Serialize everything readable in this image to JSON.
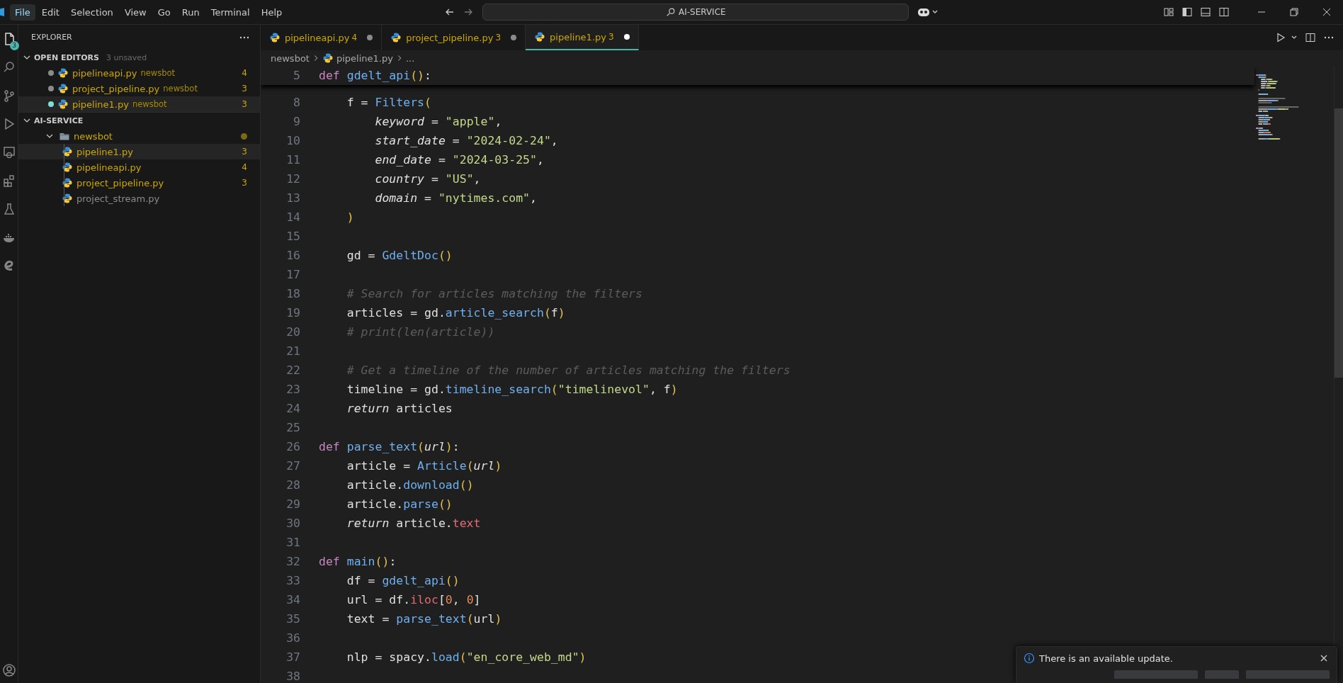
{
  "menu": [
    {
      "label": "File",
      "selected": true
    },
    {
      "label": "Edit",
      "selected": false
    },
    {
      "label": "Selection",
      "selected": false
    },
    {
      "label": "View",
      "selected": false
    },
    {
      "label": "Go",
      "selected": false
    },
    {
      "label": "Run",
      "selected": false
    },
    {
      "label": "Terminal",
      "selected": false
    },
    {
      "label": "Help",
      "selected": false
    }
  ],
  "command_center": {
    "text": "AI-SERVICE"
  },
  "activity_bar": [
    {
      "kind": "files",
      "badge": "3",
      "selected": true
    },
    {
      "kind": "search",
      "selected": false
    },
    {
      "kind": "source-control",
      "selected": false
    },
    {
      "kind": "run",
      "selected": false
    },
    {
      "kind": "remote",
      "selected": false
    },
    {
      "kind": "extensions",
      "selected": false
    },
    {
      "kind": "testing",
      "selected": false
    },
    {
      "kind": "docker",
      "selected": false
    },
    {
      "kind": "swirl",
      "selected": false
    }
  ],
  "sidebar": {
    "title": "EXPLORER",
    "open_editors": {
      "title": "OPEN EDITORS",
      "expanded": true,
      "badge": "3 unsaved",
      "items": [
        {
          "name": "pipelineapi.py",
          "folder": "newsbot",
          "problems": "4",
          "dirty": true,
          "selected": false
        },
        {
          "name": "project_pipeline.py",
          "folder": "newsbot",
          "problems": "3",
          "dirty": true,
          "selected": false
        },
        {
          "name": "pipeline1.py",
          "folder": "newsbot",
          "problems": "3",
          "dirty": true,
          "selected": true
        }
      ]
    },
    "workspace": {
      "title": "AI-SERVICE",
      "expanded": true,
      "tree": [
        {
          "name": "newsbot",
          "kind": "folder",
          "expanded": true,
          "modified": true,
          "selected": false,
          "children": [
            {
              "name": "pipeline1.py",
              "kind": "python",
              "problems": "3",
              "selected": true
            },
            {
              "name": "pipelineapi.py",
              "kind": "python",
              "problems": "4",
              "selected": false
            },
            {
              "name": "project_pipeline.py",
              "kind": "python",
              "problems": "3",
              "selected": false
            },
            {
              "name": "project_stream.py",
              "kind": "python",
              "selected": false
            }
          ]
        }
      ]
    }
  },
  "tabs": [
    {
      "label": "pipelineapi.py",
      "problems": "4",
      "dirty": true,
      "selected": false
    },
    {
      "label": "project_pipeline.py",
      "problems": "3",
      "dirty": true,
      "selected": false
    },
    {
      "label": "pipeline1.py",
      "problems": "3",
      "dirty": true,
      "selected": true
    }
  ],
  "breadcrumb": [
    {
      "label": "newsbot",
      "kind": "folder"
    },
    {
      "label": "pipeline1.py",
      "kind": "python"
    },
    {
      "label": "...",
      "kind": "symbol"
    }
  ],
  "editor": {
    "sticky": {
      "number": "5",
      "tokens": [
        {
          "kind": "keyword",
          "t": "def "
        },
        {
          "kind": "function",
          "t": "gdelt_api"
        },
        {
          "kind": "bracket",
          "t": "()"
        },
        {
          "kind": "plain",
          "t": ":"
        }
      ]
    },
    "lines": [
      {
        "number": "8",
        "tokens": [
          {
            "kind": "plain",
            "t": "    f = "
          },
          {
            "kind": "function",
            "t": "Filters"
          },
          {
            "kind": "bracket",
            "t": "("
          }
        ]
      },
      {
        "number": "9",
        "tokens": [
          {
            "kind": "parameter",
            "t": "        keyword"
          },
          {
            "kind": "plain",
            "t": " = "
          },
          {
            "kind": "string",
            "t": "\"apple\""
          },
          {
            "kind": "plain",
            "t": ","
          }
        ]
      },
      {
        "number": "10",
        "tokens": [
          {
            "kind": "parameter",
            "t": "        start_date"
          },
          {
            "kind": "plain",
            "t": " = "
          },
          {
            "kind": "string",
            "t": "\"2024-02-24\""
          },
          {
            "kind": "plain",
            "t": ","
          }
        ]
      },
      {
        "number": "11",
        "tokens": [
          {
            "kind": "parameter",
            "t": "        end_date"
          },
          {
            "kind": "plain",
            "t": " = "
          },
          {
            "kind": "string",
            "t": "\"2024-03-25\""
          },
          {
            "kind": "plain",
            "t": ","
          }
        ]
      },
      {
        "number": "12",
        "tokens": [
          {
            "kind": "parameter",
            "t": "        country"
          },
          {
            "kind": "plain",
            "t": " = "
          },
          {
            "kind": "string",
            "t": "\"US\""
          },
          {
            "kind": "plain",
            "t": ","
          }
        ]
      },
      {
        "number": "13",
        "tokens": [
          {
            "kind": "parameter",
            "t": "        domain"
          },
          {
            "kind": "plain",
            "t": " = "
          },
          {
            "kind": "string",
            "t": "\"nytimes.com\""
          },
          {
            "kind": "plain",
            "t": ","
          }
        ]
      },
      {
        "number": "14",
        "tokens": [
          {
            "kind": "bracket",
            "t": "    )"
          }
        ]
      },
      {
        "number": "15"
      },
      {
        "number": "16",
        "tokens": [
          {
            "kind": "plain",
            "t": "    gd = "
          },
          {
            "kind": "function",
            "t": "GdeltDoc"
          },
          {
            "kind": "bracket",
            "t": "()"
          }
        ]
      },
      {
        "number": "17"
      },
      {
        "number": "18",
        "tokens": [
          {
            "kind": "comment",
            "t": "    # Search for articles matching the filters"
          }
        ]
      },
      {
        "number": "19",
        "tokens": [
          {
            "kind": "plain",
            "t": "    articles = gd."
          },
          {
            "kind": "function",
            "t": "article_search"
          },
          {
            "kind": "bracket",
            "t": "("
          },
          {
            "kind": "plain",
            "t": "f"
          },
          {
            "kind": "bracket",
            "t": ")"
          }
        ]
      },
      {
        "number": "20",
        "tokens": [
          {
            "kind": "comment",
            "t": "    # print(len(article))"
          }
        ]
      },
      {
        "number": "21"
      },
      {
        "number": "22",
        "tokens": [
          {
            "kind": "comment",
            "t": "    # Get a timeline of the number of articles matching the filters"
          }
        ]
      },
      {
        "number": "23",
        "tokens": [
          {
            "kind": "plain",
            "t": "    timeline = gd."
          },
          {
            "kind": "function",
            "t": "timeline_search"
          },
          {
            "kind": "bracket",
            "t": "("
          },
          {
            "kind": "string",
            "t": "\"timelinevol\""
          },
          {
            "kind": "plain",
            "t": ", f"
          },
          {
            "kind": "bracket",
            "t": ")"
          }
        ]
      },
      {
        "number": "24",
        "tokens": [
          {
            "kind": "control",
            "t": "    return"
          },
          {
            "kind": "plain",
            "t": " articles"
          }
        ]
      },
      {
        "number": "25"
      },
      {
        "number": "26",
        "tokens": [
          {
            "kind": "keyword",
            "t": "def "
          },
          {
            "kind": "function",
            "t": "parse_text"
          },
          {
            "kind": "bracket",
            "t": "("
          },
          {
            "kind": "parameter",
            "t": "url"
          },
          {
            "kind": "bracket",
            "t": ")"
          },
          {
            "kind": "plain",
            "t": ":"
          }
        ]
      },
      {
        "number": "27",
        "tokens": [
          {
            "kind": "plain",
            "t": "    article = "
          },
          {
            "kind": "function",
            "t": "Article"
          },
          {
            "kind": "bracket",
            "t": "("
          },
          {
            "kind": "parameter",
            "t": "url"
          },
          {
            "kind": "bracket",
            "t": ")"
          }
        ]
      },
      {
        "number": "28",
        "tokens": [
          {
            "kind": "plain",
            "t": "    article."
          },
          {
            "kind": "function",
            "t": "download"
          },
          {
            "kind": "bracket",
            "t": "()"
          }
        ]
      },
      {
        "number": "29",
        "tokens": [
          {
            "kind": "plain",
            "t": "    article."
          },
          {
            "kind": "function",
            "t": "parse"
          },
          {
            "kind": "bracket",
            "t": "()"
          }
        ]
      },
      {
        "number": "30",
        "tokens": [
          {
            "kind": "control",
            "t": "    return"
          },
          {
            "kind": "plain",
            "t": " article."
          },
          {
            "kind": "attribute",
            "t": "text"
          }
        ]
      },
      {
        "number": "31"
      },
      {
        "number": "32",
        "tokens": [
          {
            "kind": "keyword",
            "t": "def "
          },
          {
            "kind": "function",
            "t": "main"
          },
          {
            "kind": "bracket",
            "t": "()"
          },
          {
            "kind": "plain",
            "t": ":"
          }
        ]
      },
      {
        "number": "33",
        "tokens": [
          {
            "kind": "plain",
            "t": "    df = "
          },
          {
            "kind": "function",
            "t": "gdelt_api"
          },
          {
            "kind": "bracket",
            "t": "()"
          }
        ]
      },
      {
        "number": "34",
        "tokens": [
          {
            "kind": "plain",
            "t": "    url = df."
          },
          {
            "kind": "attribute",
            "t": "iloc"
          },
          {
            "kind": "plain",
            "t": "["
          },
          {
            "kind": "number",
            "t": "0"
          },
          {
            "kind": "plain",
            "t": ", "
          },
          {
            "kind": "number",
            "t": "0"
          },
          {
            "kind": "plain",
            "t": "]"
          }
        ]
      },
      {
        "number": "35",
        "tokens": [
          {
            "kind": "plain",
            "t": "    text = "
          },
          {
            "kind": "function",
            "t": "parse_text"
          },
          {
            "kind": "bracket",
            "t": "("
          },
          {
            "kind": "plain",
            "t": "url"
          },
          {
            "kind": "bracket",
            "t": ")"
          }
        ]
      },
      {
        "number": "36"
      },
      {
        "number": "37",
        "tokens": [
          {
            "kind": "plain",
            "t": "    nlp = spacy."
          },
          {
            "kind": "function",
            "t": "load"
          },
          {
            "kind": "bracket",
            "t": "("
          },
          {
            "kind": "string",
            "t": "\"en_core_web_md\""
          },
          {
            "kind": "bracket",
            "t": ")"
          }
        ]
      },
      {
        "number": "38"
      }
    ]
  },
  "notification": {
    "kind": "info",
    "message": "There is an available update."
  }
}
